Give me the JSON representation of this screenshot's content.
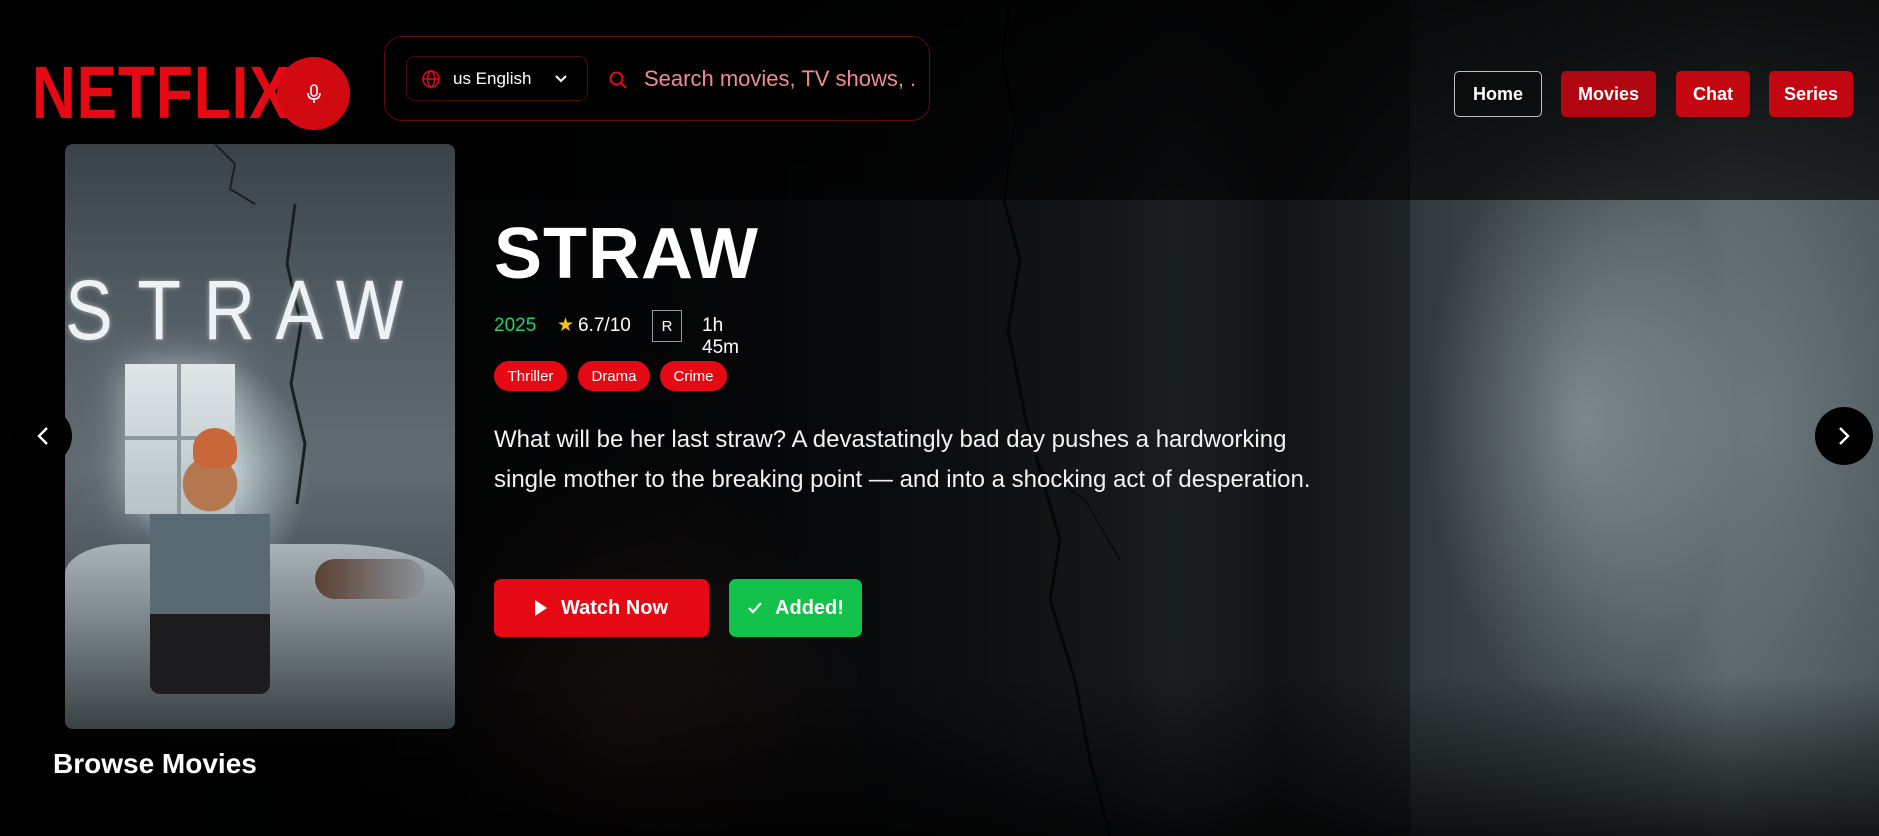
{
  "brand": {
    "logo": "NETFLIX",
    "accent": "#e50914"
  },
  "header": {
    "mic_icon": "microphone-icon",
    "language": {
      "icon": "globe-icon",
      "selected": "us English",
      "chevron": "chevron-down-icon"
    },
    "search": {
      "icon": "search-icon",
      "placeholder": "Search movies, TV shows, ..."
    },
    "nav": [
      {
        "label": "Home",
        "active": true
      },
      {
        "label": "Movies"
      },
      {
        "label": "Chat"
      },
      {
        "label": "Series"
      }
    ]
  },
  "hero": {
    "poster_title_letters": [
      "S",
      "T",
      "R",
      "A",
      "W"
    ],
    "title": "STRAW",
    "year": "2025",
    "star": "★",
    "rating": "6.7/10",
    "certification": "R",
    "runtime": "1h 45m",
    "genres": [
      "Thriller",
      "Drama",
      "Crime"
    ],
    "description": "What will be her last straw? A devastatingly bad day pushes a hardworking single mother to the breaking point — and into a shocking act of desperation.",
    "watch_label": "Watch Now",
    "added_label": "Added!",
    "colors": {
      "year": "#1fd36a",
      "star": "#f4c21a",
      "added": "#12c24a"
    }
  },
  "carousel": {
    "prev_icon": "chevron-left-icon",
    "next_icon": "chevron-right-icon"
  },
  "section": {
    "browse_title": "Browse Movies"
  }
}
